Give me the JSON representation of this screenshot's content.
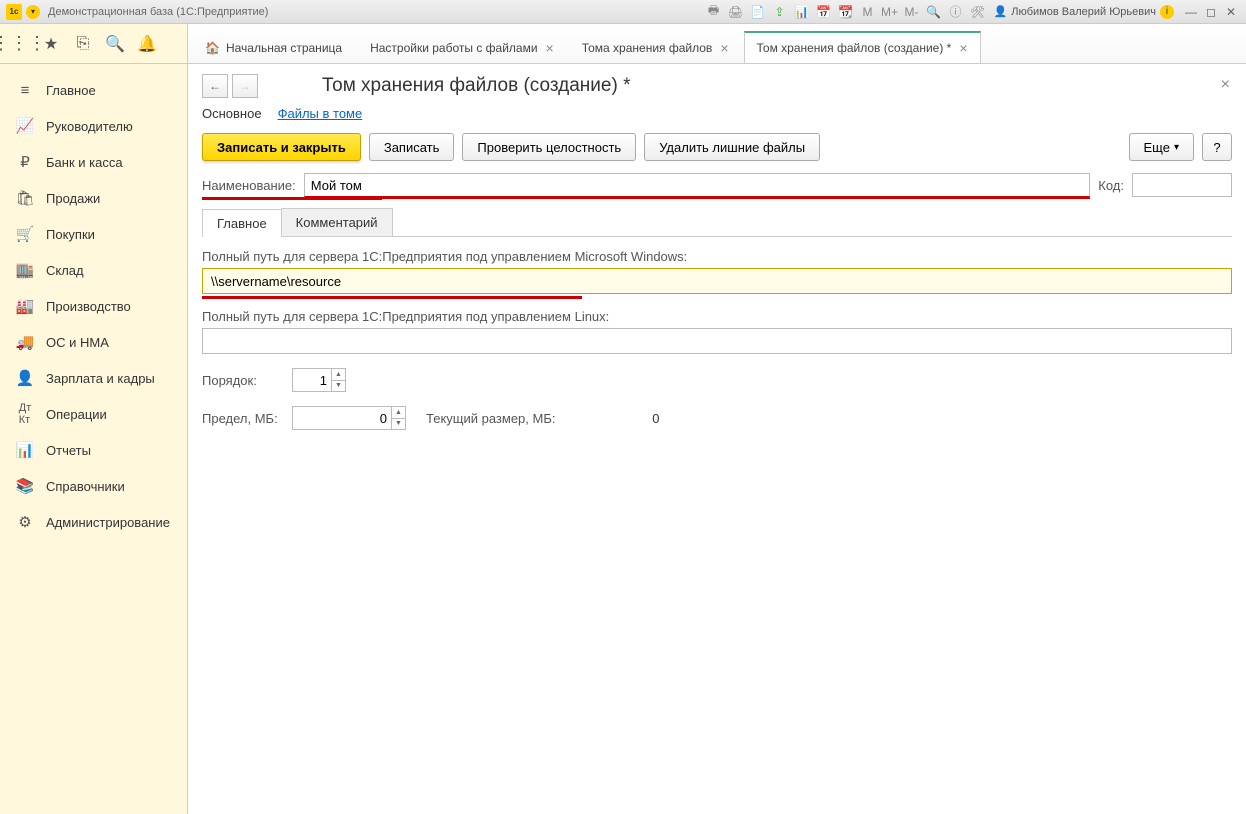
{
  "titlebar": {
    "app_title": "Демонстрационная база  (1С:Предприятие)",
    "user_name": "Любимов Валерий Юрьевич",
    "m_labels": [
      "M",
      "M+",
      "M-"
    ]
  },
  "toolcol_icons": [
    "apps",
    "star",
    "link",
    "search",
    "bell"
  ],
  "tabs": [
    {
      "label": "Начальная страница",
      "home": true,
      "closable": false
    },
    {
      "label": "Настройки работы с файлами",
      "closable": true
    },
    {
      "label": "Тома хранения файлов",
      "closable": true
    },
    {
      "label": "Том хранения файлов (создание) *",
      "closable": true,
      "active": true
    }
  ],
  "sidebar": [
    {
      "icon": "≡",
      "label": "Главное"
    },
    {
      "icon": "📈",
      "label": "Руководителю"
    },
    {
      "icon": "₽",
      "label": "Банк и касса"
    },
    {
      "icon": "🛍",
      "label": "Продажи"
    },
    {
      "icon": "🛒",
      "label": "Покупки"
    },
    {
      "icon": "🏬",
      "label": "Склад"
    },
    {
      "icon": "🏭",
      "label": "Производство"
    },
    {
      "icon": "🚚",
      "label": "ОС и НМА"
    },
    {
      "icon": "👤",
      "label": "Зарплата и кадры"
    },
    {
      "icon": "ᴬᵏ",
      "label": "Операции"
    },
    {
      "icon": "📊",
      "label": "Отчеты"
    },
    {
      "icon": "📚",
      "label": "Справочники"
    },
    {
      "icon": "⚙",
      "label": "Администрирование"
    }
  ],
  "page": {
    "title": "Том хранения файлов (создание) *",
    "subtabs": {
      "main": "Основное",
      "files": "Файлы в томе"
    },
    "buttons": {
      "save_close": "Записать и закрыть",
      "save": "Записать",
      "check": "Проверить целостность",
      "delete_extra": "Удалить лишние файлы",
      "more": "Еще",
      "help": "?"
    },
    "labels": {
      "name": "Наименование:",
      "code": "Код:",
      "tab_main": "Главное",
      "tab_comment": "Комментарий",
      "path_win": "Полный путь для сервера 1С:Предприятия под управлением Microsoft Windows:",
      "path_linux": "Полный путь для сервера 1С:Предприятия под управлением Linux:",
      "order": "Порядок:",
      "limit": "Предел, МБ:",
      "current": "Текущий размер, МБ:"
    },
    "values": {
      "name": "Мой том",
      "code": "",
      "path_win": "\\\\servername\\resource",
      "path_linux": "",
      "order": "1",
      "limit": "0",
      "current": "0"
    }
  }
}
